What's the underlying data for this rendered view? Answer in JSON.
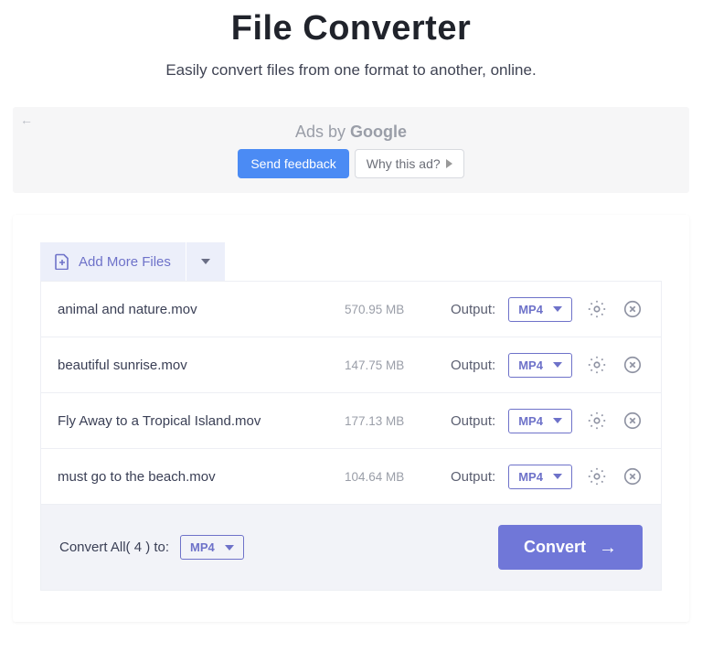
{
  "header": {
    "title": "File Converter",
    "subtitle": "Easily convert files from one format to another, online."
  },
  "ad": {
    "byline": "Ads by ",
    "brand": "Google",
    "send_feedback": "Send feedback",
    "why": "Why this ad?"
  },
  "toolbar": {
    "add_more_label": "Add More Files"
  },
  "output_label": "Output:",
  "files": [
    {
      "name": "animal and nature.mov",
      "size": "570.95 MB",
      "format": "MP4"
    },
    {
      "name": "beautiful sunrise.mov",
      "size": "147.75 MB",
      "format": "MP4"
    },
    {
      "name": "Fly Away to a Tropical Island.mov",
      "size": "177.13 MB",
      "format": "MP4"
    },
    {
      "name": "must go to the beach.mov",
      "size": "104.64 MB",
      "format": "MP4"
    }
  ],
  "footer": {
    "convert_all_label": "Convert All( 4 ) to:",
    "all_format": "MP4",
    "convert_label": "Convert"
  }
}
